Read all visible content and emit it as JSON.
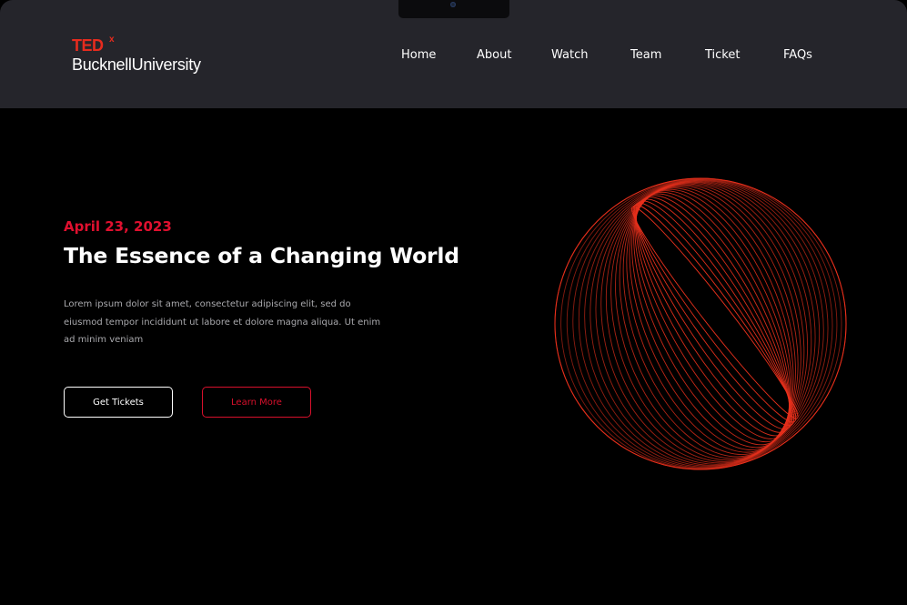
{
  "header": {
    "logo": {
      "brand": "TED",
      "superscript": "x",
      "subtitle": "BucknellUniversity"
    },
    "nav": [
      {
        "label": "Home"
      },
      {
        "label": "About"
      },
      {
        "label": "Watch"
      },
      {
        "label": "Team"
      },
      {
        "label": "Ticket"
      },
      {
        "label": "FAQs"
      }
    ]
  },
  "hero": {
    "date": "April 23, 2023",
    "title": "The Essence of a Changing World",
    "description": "Lorem ipsum dolor sit amet, consectetur adipiscing elit, sed do eiusmod tempor incididunt ut labore et dolore magna aliqua. Ut enim ad minim veniam",
    "buttons": {
      "primary": "Get Tickets",
      "secondary": "Learn More"
    },
    "graphic": {
      "icon": "spiral-sphere-graphic",
      "color": "#e8301c"
    }
  },
  "colors": {
    "brand_red": "#e62b1e",
    "accent_red": "#e0102f",
    "header_bg": "#25252b",
    "page_bg": "#000000"
  }
}
